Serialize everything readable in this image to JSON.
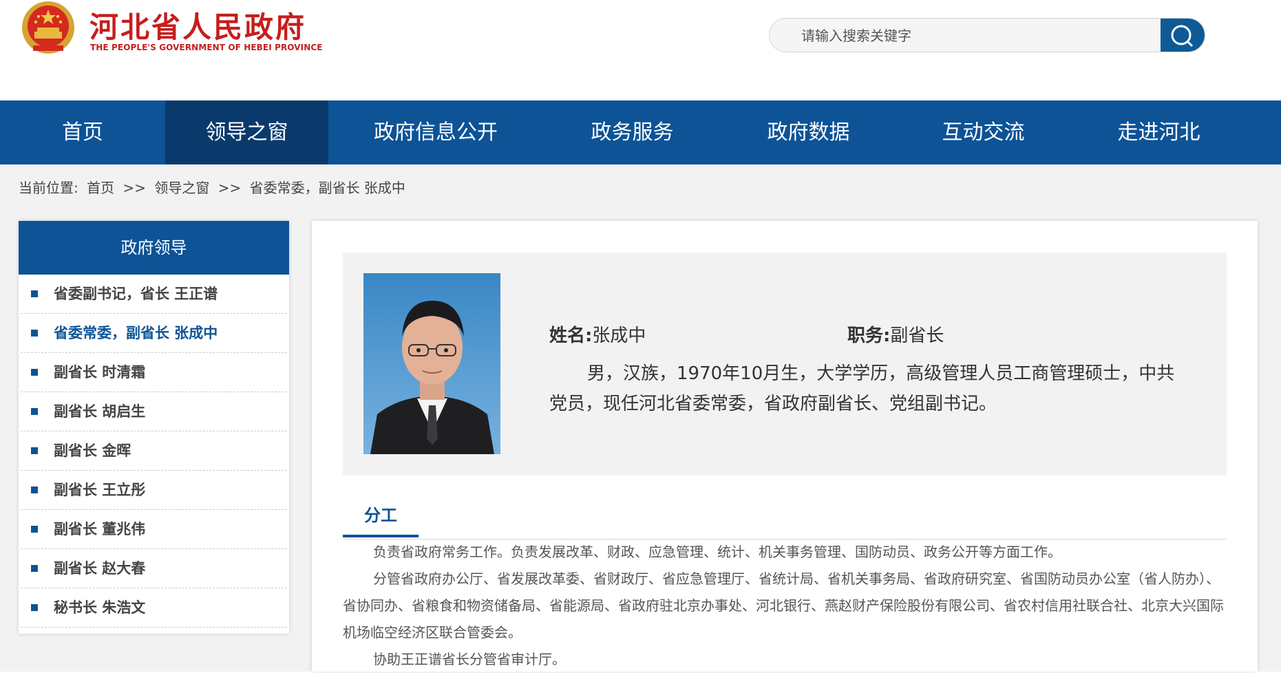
{
  "header": {
    "title": "河北省人民政府",
    "subtitle": "THE PEOPLE'S GOVERNMENT OF HEBEI PROVINCE",
    "search_placeholder": "请输入搜索关键字",
    "search_icon": "search-icon"
  },
  "nav": {
    "items": [
      {
        "label": "首页"
      },
      {
        "label": "领导之窗"
      },
      {
        "label": "政府信息公开"
      },
      {
        "label": "政务服务"
      },
      {
        "label": "政府数据"
      },
      {
        "label": "互动交流"
      },
      {
        "label": "走进河北"
      }
    ]
  },
  "breadcrumb": {
    "prefix": "当前位置:",
    "items": [
      "首页",
      ">>",
      "领导之窗",
      ">>",
      "省委常委，副省长 张成中"
    ]
  },
  "sidebar": {
    "title": "政府领导",
    "items": [
      {
        "label": "省委副书记，省长 王正谱"
      },
      {
        "label": "省委常委，副省长 张成中"
      },
      {
        "label": "副省长 时清霜"
      },
      {
        "label": "副省长 胡启生"
      },
      {
        "label": "副省长 金晖"
      },
      {
        "label": "副省长 王立彤"
      },
      {
        "label": "副省长 董兆伟"
      },
      {
        "label": "副省长 赵大春"
      },
      {
        "label": "秘书长 朱浩文"
      }
    ]
  },
  "profile": {
    "name_key": "姓名:",
    "name_value": "张成中",
    "post_key": "职务:",
    "post_value": "副省长",
    "bio": "男，汉族，1970年10月生，大学学历，高级管理人员工商管理硕士，中共党员，现任河北省委常委，省政府副省长、党组副书记。"
  },
  "duties": {
    "tab_label": "分工",
    "paragraphs": [
      "负责省政府常务工作。负责发展改革、财政、应急管理、统计、机关事务管理、国防动员、政务公开等方面工作。",
      "分管省政府办公厅、省发展改革委、省财政厅、省应急管理厅、省统计局、省机关事务局、省政府研究室、省国防动员办公室（省人防办）、省协同办、省粮食和物资储备局、省能源局、省政府驻北京办事处、河北银行、燕赵财产保险股份有限公司、省农村信用社联合社、北京大兴国际机场临空经济区联合管委会。",
      "协助王正谱省长分管省审计厅。"
    ]
  },
  "colors": {
    "brand_red": "#c61d1d",
    "nav_blue": "#0d5396",
    "nav_active": "#0a3a6c"
  }
}
